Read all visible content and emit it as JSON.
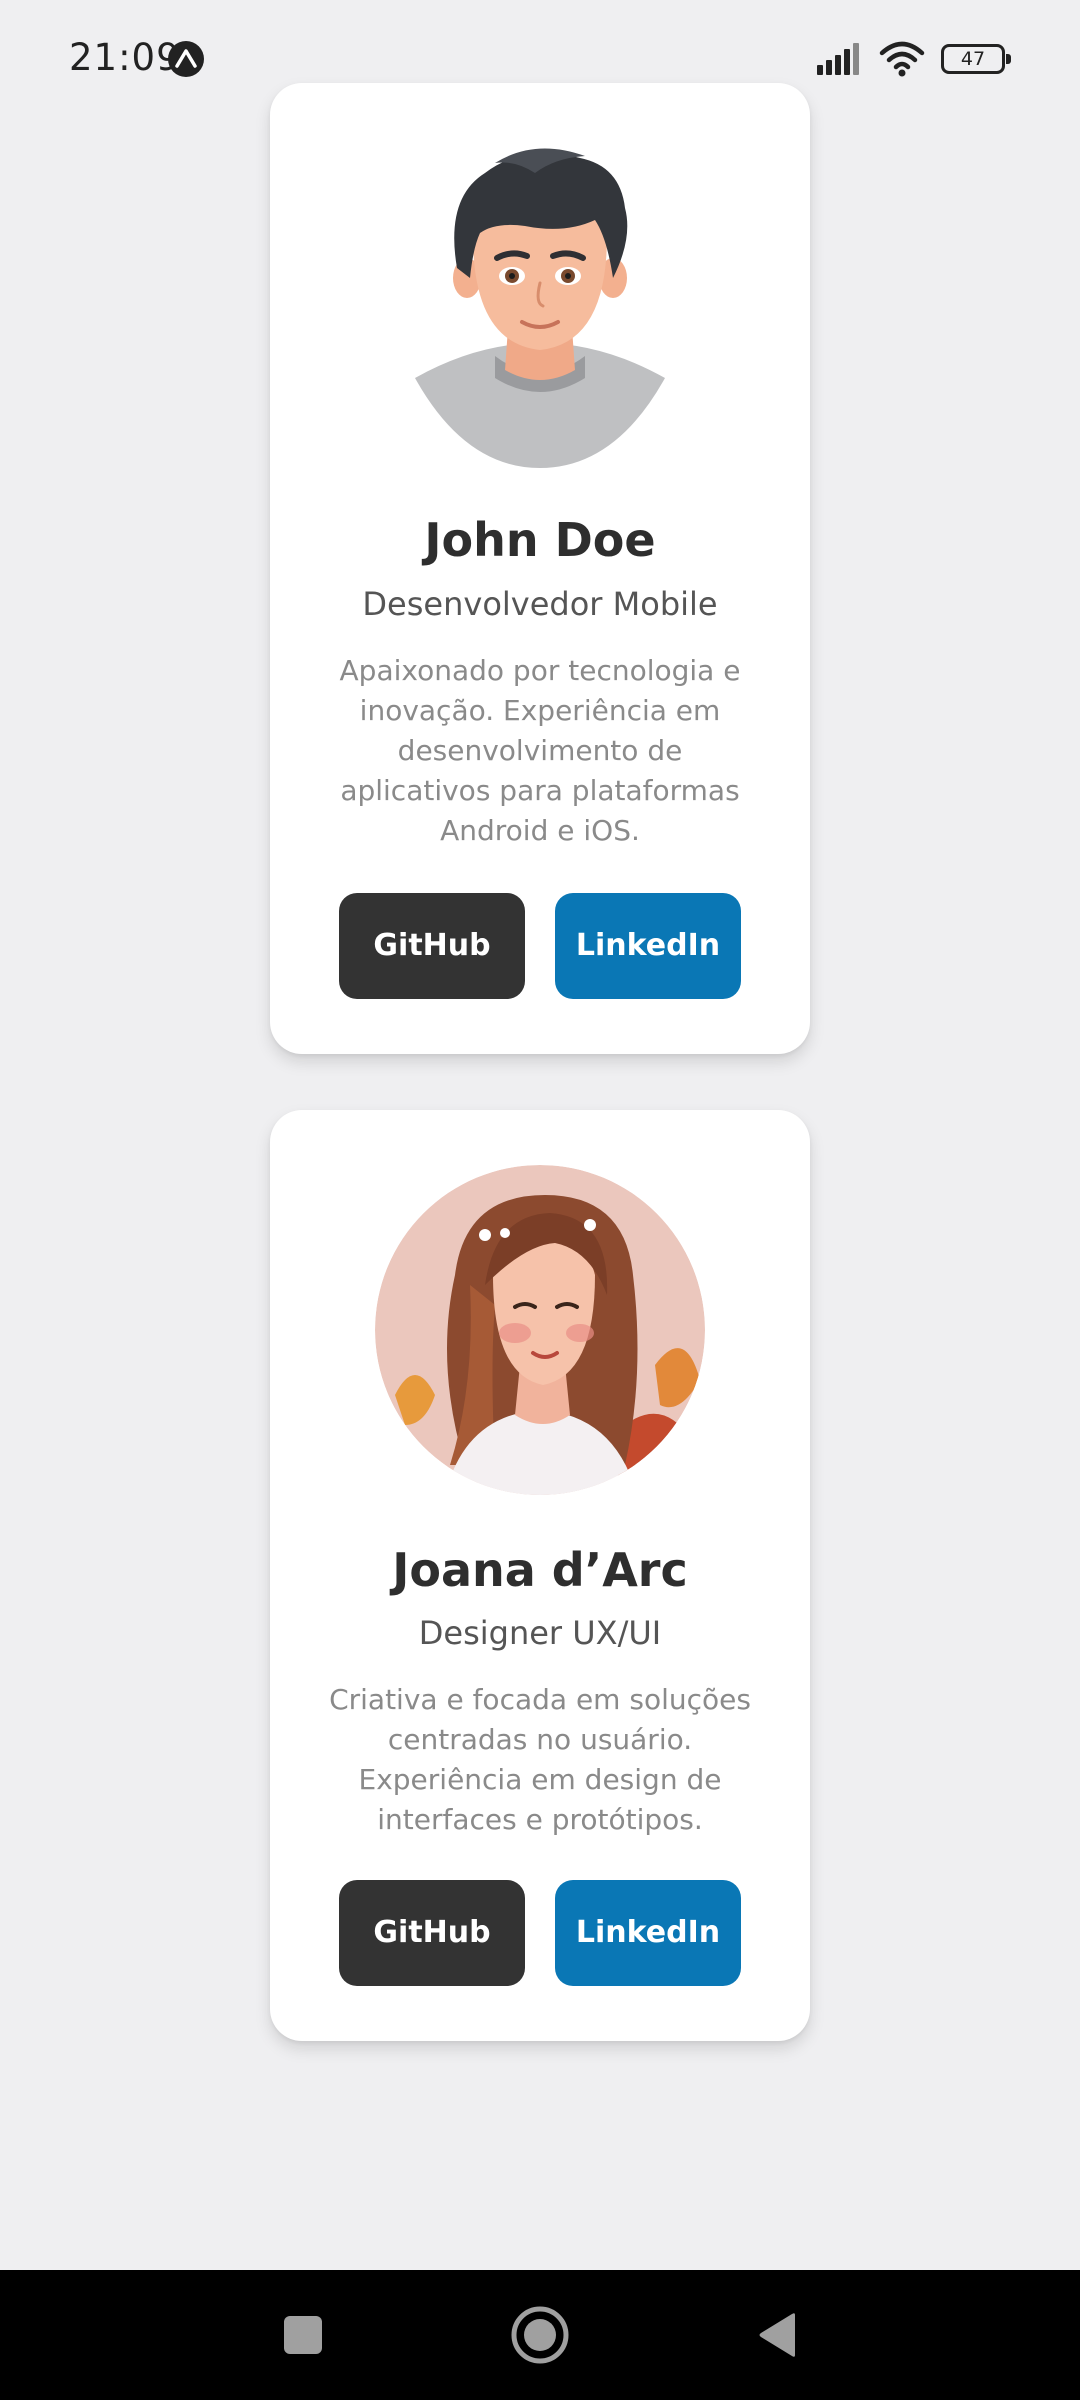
{
  "status_bar": {
    "time": "21:09",
    "battery": "47",
    "app_icon": "expo-icon"
  },
  "profiles": [
    {
      "name": "John Doe",
      "role": "Desenvolvedor Mobile",
      "bio": "Apaixonado por tecnologia e inovação. Experiência em desenvolvimento de aplicativos para plataformas Android e iOS.",
      "avatar_icon": "cartoon-man-avatar",
      "github_label": "GitHub",
      "linkedin_label": "LinkedIn"
    },
    {
      "name": "Joana d’Arc",
      "role": "Designer UX/UI",
      "bio": "Criativa e focada em soluções centradas no usuário. Experiência em design de interfaces e protótipos.",
      "avatar_icon": "illustrated-woman-avatar",
      "github_label": "GitHub",
      "linkedin_label": "LinkedIn"
    }
  ],
  "colors": {
    "background": "#efeff1",
    "github_button": "#333333",
    "linkedin_button": "#0a77b5"
  },
  "nav_bar": {
    "recent_icon": "square-icon",
    "home_icon": "circle-icon",
    "back_icon": "triangle-back-icon"
  }
}
